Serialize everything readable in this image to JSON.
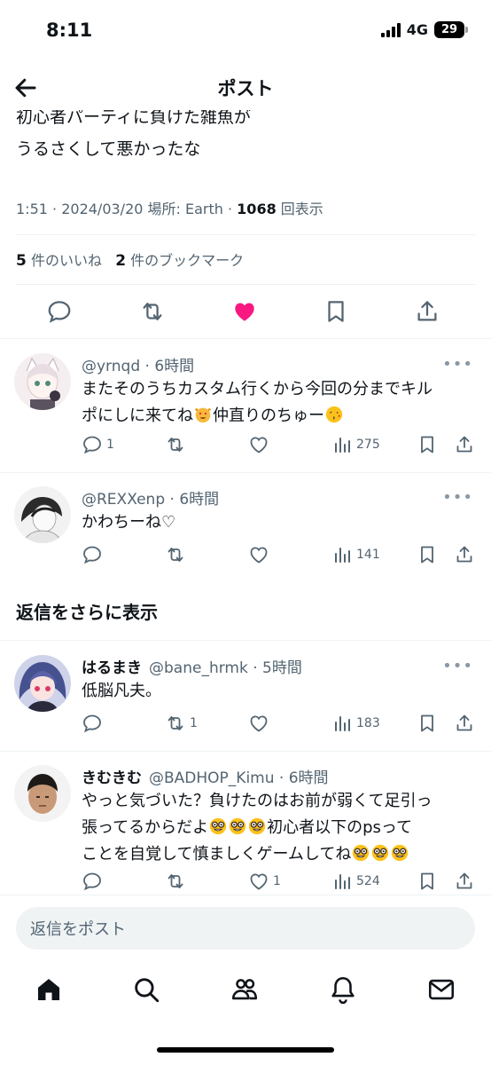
{
  "status_bar": {
    "time": "8:11",
    "network": "4G",
    "battery": "29"
  },
  "header": {
    "title": "ポスト"
  },
  "tweet": {
    "lines": [
      "初心者パーティに負けた雑魚が",
      "うるさくして悪かったな"
    ],
    "time": "1:51",
    "date": "2024/03/20",
    "location_label": "場所: Earth",
    "views": "1068",
    "views_suffix": "回表示",
    "likes": "5",
    "likes_suffix": "件のいいね",
    "bookmarks": "2",
    "bookmarks_suffix": "件のブックマーク"
  },
  "replies": [
    {
      "name": "",
      "handle": "@yrnqd",
      "time": "6時間",
      "lines": [
        "またそのうちカスタム行くから今回の分までキル",
        "ポにしに来てね",
        "仲直りのちゅー"
      ],
      "reply_count": "1",
      "retweet_count": "",
      "like_count": "",
      "views": "275"
    },
    {
      "name": "",
      "handle": "@REXXenp",
      "time": "6時間",
      "lines": [
        "かわちーね♡"
      ],
      "reply_count": "",
      "retweet_count": "",
      "like_count": "",
      "views": "141"
    },
    {
      "name": "はるまき",
      "handle": "@bane_hrmk",
      "time": "5時間",
      "lines": [
        "低脳凡夫。"
      ],
      "reply_count": "",
      "retweet_count": "1",
      "like_count": "",
      "views": "183"
    },
    {
      "name": "きむきむ",
      "handle": "@BADHOP_Kimu",
      "time": "6時間",
      "lines": [
        "やっと気づいた？負けたのはお前が弱くて足引っ",
        "張ってるからだよ",
        "初心者以下のpsって",
        "ことを自覚して慎ましくゲームしてね"
      ],
      "reply_count": "",
      "retweet_count": "",
      "like_count": "1",
      "views": "524"
    }
  ],
  "more_replies_label": "返信をさらに表示",
  "compose": {
    "placeholder": "返信をポスト"
  },
  "colors": {
    "like": "#f91880",
    "text": "#0f1419",
    "secondary": "#536471",
    "divider": "#eff3f4"
  },
  "icons": [
    "back-arrow-icon",
    "reply-icon",
    "retweet-icon",
    "heart-icon",
    "bookmark-icon",
    "share-icon",
    "views-icon",
    "home-icon",
    "search-icon",
    "communities-icon",
    "notifications-icon",
    "messages-icon"
  ]
}
